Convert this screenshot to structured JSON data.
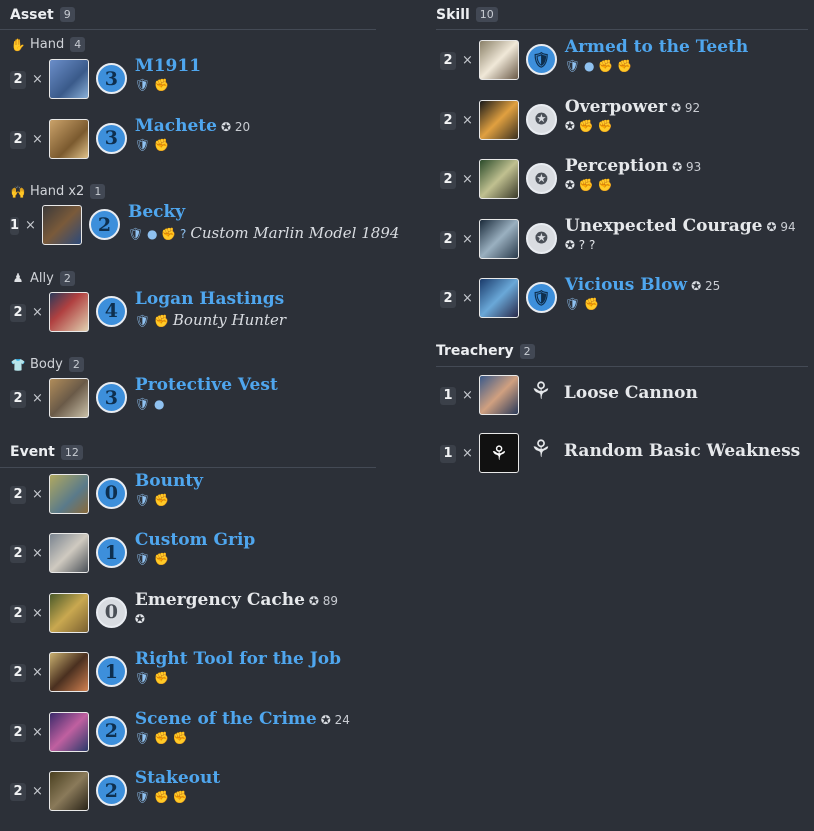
{
  "left": {
    "asset": {
      "title": "Asset",
      "count": "9",
      "groups": [
        {
          "label": "Hand",
          "count": "4",
          "icon": "hand-icon",
          "glyph": "✋",
          "cards": [
            {
              "qty": "2",
              "name": "M1911",
              "cost": "3",
              "color": "blue",
              "icons": "🛡 ✊",
              "text": ""
            },
            {
              "qty": "2",
              "name": "Machete",
              "cost": "3",
              "color": "blue",
              "xp": "20",
              "icons": "🛡 ✊",
              "text": ""
            }
          ]
        },
        {
          "label": "Hand x2",
          "count": "1",
          "icon": "hands-icon",
          "glyph": "🙌",
          "cards": [
            {
              "qty": "1",
              "name": "Becky",
              "cost": "2",
              "color": "blue",
              "icons": "🛡 ● ✊ ?",
              "text": "Custom Marlin Model 1894"
            }
          ]
        },
        {
          "label": "Ally",
          "count": "2",
          "icon": "ally-icon",
          "glyph": "♟",
          "cards": [
            {
              "qty": "2",
              "name": "Logan Hastings",
              "cost": "4",
              "color": "blue",
              "icons": "🛡 ✊",
              "text": "Bounty Hunter"
            }
          ]
        },
        {
          "label": "Body",
          "count": "2",
          "icon": "body-icon",
          "glyph": "👕",
          "cards": [
            {
              "qty": "2",
              "name": "Protective Vest",
              "cost": "3",
              "color": "blue",
              "icons": "🛡 ●",
              "text": ""
            }
          ]
        }
      ]
    },
    "event": {
      "title": "Event",
      "count": "12",
      "cards": [
        {
          "qty": "2",
          "name": "Bounty",
          "cost": "0",
          "color": "blue",
          "icons": "🛡 ✊"
        },
        {
          "qty": "2",
          "name": "Custom Grip",
          "cost": "1",
          "color": "blue",
          "icons": "🛡 ✊"
        },
        {
          "qty": "2",
          "name": "Emergency Cache",
          "cost": "0",
          "color": "grey",
          "xp": "89",
          "icons": "✪"
        },
        {
          "qty": "2",
          "name": "Right Tool for the Job",
          "cost": "1",
          "color": "blue",
          "icons": "🛡 ✊"
        },
        {
          "qty": "2",
          "name": "Scene of the Crime",
          "cost": "2",
          "color": "blue",
          "xp": "24",
          "icons": "🛡 ✊ ✊"
        },
        {
          "qty": "2",
          "name": "Stakeout",
          "cost": "2",
          "color": "blue",
          "icons": "🛡 ✊ ✊"
        }
      ]
    }
  },
  "right": {
    "skill": {
      "title": "Skill",
      "count": "10",
      "cards": [
        {
          "qty": "2",
          "name": "Armed to the Teeth",
          "color": "blue",
          "icons": "🛡 ● ✊ ✊"
        },
        {
          "qty": "2",
          "name": "Overpower",
          "color": "grey",
          "xp": "92",
          "icons": "✪ ✊ ✊"
        },
        {
          "qty": "2",
          "name": "Perception",
          "color": "grey",
          "xp": "93",
          "icons": "✪ ✊ ✊"
        },
        {
          "qty": "2",
          "name": "Unexpected Courage",
          "color": "grey",
          "xp": "94",
          "icons": "✪ ? ?"
        },
        {
          "qty": "2",
          "name": "Vicious Blow",
          "color": "blue",
          "xp": "25",
          "icons": "🛡 ✊"
        }
      ]
    },
    "treachery": {
      "title": "Treachery",
      "count": "2",
      "cards": [
        {
          "qty": "1",
          "name": "Loose Cannon"
        },
        {
          "qty": "1",
          "name": "Random Basic Weakness"
        }
      ]
    }
  },
  "glyphs": {
    "times": "×",
    "xp_icon": "✪",
    "weakness_icon": "⚘",
    "skill_icon": "✪",
    "class_icon": "🛡"
  },
  "colors": {
    "background": "#2c3038",
    "guardian_blue": "#4fa6ee",
    "neutral": "#e6e8eb"
  }
}
